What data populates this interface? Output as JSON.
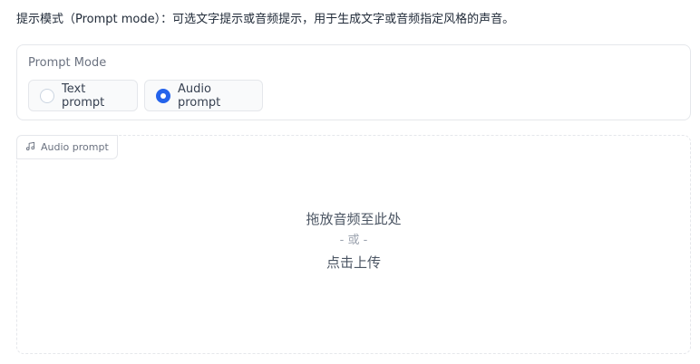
{
  "description": "提示模式（Prompt mode）：可选文字提示或音频提示，用于生成文字或音频指定风格的声音。",
  "prompt_mode": {
    "label": "Prompt Mode",
    "options": [
      {
        "label": "Text prompt",
        "selected": false
      },
      {
        "label": "Audio prompt",
        "selected": true
      }
    ]
  },
  "audio_upload": {
    "tag_label": "Audio prompt",
    "tag_icon": "music-note-icon",
    "drop_text": "拖放音频至此处",
    "or_text": "- 或 -",
    "click_text": "点击上传"
  },
  "colors": {
    "accent": "#2563eb",
    "border": "#e5e7eb",
    "muted_text": "#6b7280"
  }
}
